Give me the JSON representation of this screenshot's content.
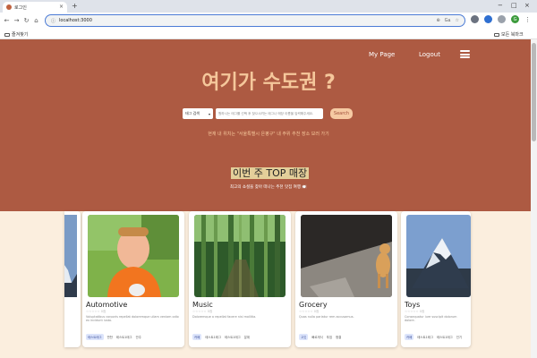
{
  "browser": {
    "tab_title": "로그인",
    "tab_close": "×",
    "new_tab": "+",
    "window_controls": [
      "−",
      "□",
      "×"
    ],
    "url": "localhost:3000",
    "nav_icons": [
      "←",
      "→",
      "↻",
      "⌂"
    ],
    "omnibox_icons": [
      "⊕",
      "Gᴀ",
      "☆"
    ],
    "profile_initial": "G",
    "bookmarks": {
      "left": "즐겨찾기",
      "right": "모든 북마크"
    }
  },
  "nav": {
    "my_page": "My Page",
    "logout": "Logout"
  },
  "hero": {
    "headline": "여기가 수도권 ?",
    "search": {
      "select": "태그 검색",
      "placeholder": "원하시는 태그를 선택 후 찾으시려는 태그나 매장 이름을 입력해주세요.",
      "button": "Search"
    },
    "hint": "현재 내 위치는 \"서울특별시 은평구\" 내 주위 추천 장소 보러 가기"
  },
  "section": {
    "title": "이번 주 TOP 매장",
    "subtitle": "최고의 쇼셜을 찾아 떠나는 추천 맛집 여행 🍽️"
  },
  "cards": [
    {
      "title": "Automotive",
      "stars": "☆☆☆☆☆ 0점",
      "desc": "Voluptatibus corporis repellat doloremque ullam veniam odio ex incidunt iusto.",
      "tags": [
        "테스트태그",
        "반찬",
        "테스트1태그",
        "안주"
      ],
      "image": "child-icon"
    },
    {
      "title": "Music",
      "stars": "☆☆☆☆☆ 0점",
      "desc": "Doloremque a repellat facere nisi mollitia.",
      "tags": [
        "카페",
        "테스트1태그",
        "테스트1태그",
        "분위"
      ],
      "image": "bamboo-forest"
    },
    {
      "title": "Grocery",
      "stars": "☆☆☆☆☆ 0점",
      "desc": "Quas nulla pariatur rem accusamus.",
      "tags": [
        "고깃",
        "빠르게식",
        "푸짐",
        "청결"
      ],
      "image": "cat-on-street"
    },
    {
      "title": "Toys",
      "stars": "☆☆☆☆☆ 0점",
      "desc": "Consequatur iure suscipit dolorum dolore.",
      "tags": [
        "카페",
        "테스트1태그",
        "테스트1태그",
        "인기"
      ],
      "image": "mountain-peak"
    }
  ],
  "colors": {
    "hero": "#ad5a42",
    "accent": "#f5c79b",
    "page_bg": "#fbeede",
    "button": "#f6caa3"
  }
}
